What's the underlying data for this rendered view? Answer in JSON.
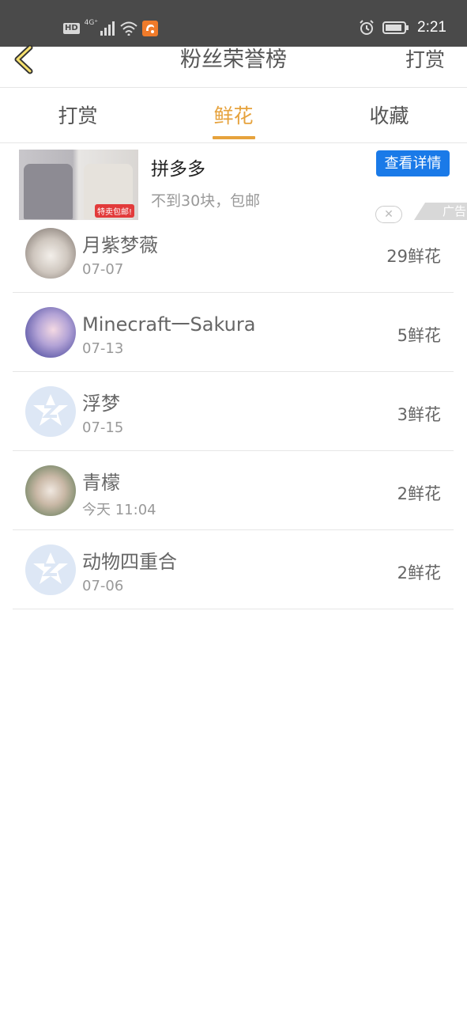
{
  "status_bar": {
    "hd": "HD",
    "network": "4G⁺",
    "time": "2:21"
  },
  "header": {
    "title": "粉丝荣誉榜",
    "action": "打赏"
  },
  "tabs": [
    {
      "label": "打赏",
      "active": false
    },
    {
      "label": "鲜花",
      "active": true
    },
    {
      "label": "收藏",
      "active": false
    }
  ],
  "ad": {
    "title": "拼多多",
    "description": "不到30块，包邮",
    "button": "查看详情",
    "image_tag": "特卖包邮!",
    "badge": "广告"
  },
  "fans": [
    {
      "name": "月紫梦薇",
      "date": "07-07",
      "count": "29鲜花",
      "avatar": "cat-photo"
    },
    {
      "name": "Minecraft一Sakura",
      "date": "07-13",
      "count": "5鲜花",
      "avatar": "anime-girl"
    },
    {
      "name": "浮梦",
      "date": "07-15",
      "count": "3鲜花",
      "avatar": "default-avatar"
    },
    {
      "name": "青檬",
      "date": "今天 11:04",
      "count": "2鲜花",
      "avatar": "flower-photo"
    },
    {
      "name": "动物四重合",
      "date": "07-06",
      "count": "2鲜花",
      "avatar": "default-avatar"
    }
  ],
  "colors": {
    "accent": "#e6a23c",
    "ad_button": "#1a7ae8",
    "status_bar": "#4a4a4a"
  }
}
